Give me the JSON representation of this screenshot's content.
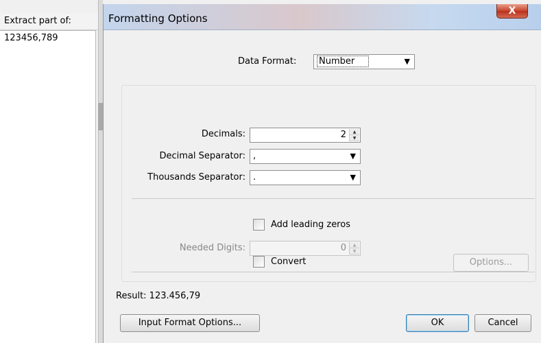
{
  "left_panel": {
    "header": "Extract part of:",
    "value": "123456,789"
  },
  "dialog": {
    "title": "Formatting Options",
    "close_glyph": "X",
    "data_format_label": "Data Format:",
    "data_format_value": "Number",
    "decimals_label": "Decimals:",
    "decimals_value": "2",
    "decimal_separator_label": "Decimal Separator:",
    "decimal_separator_value": ",",
    "thousands_separator_label": "Thousands Separator:",
    "thousands_separator_value": ".",
    "add_leading_zeros_label": "Add leading zeros",
    "needed_digits_label": "Needed Digits:",
    "needed_digits_value": "0",
    "convert_label": "Convert",
    "options_button": "Options...",
    "result_label": "Result: 123.456,79",
    "input_format_button": "Input Format Options...",
    "ok_button": "OK",
    "cancel_button": "Cancel"
  },
  "icons": {
    "dropdown": "chevron-down-icon",
    "spin_up": "spin-up-icon",
    "spin_down": "spin-down-icon",
    "close": "close-icon"
  },
  "colors": {
    "close_button": "#c7432c",
    "titlebar": "#c3d5ec",
    "default_button_border": "#3c7fb1"
  }
}
